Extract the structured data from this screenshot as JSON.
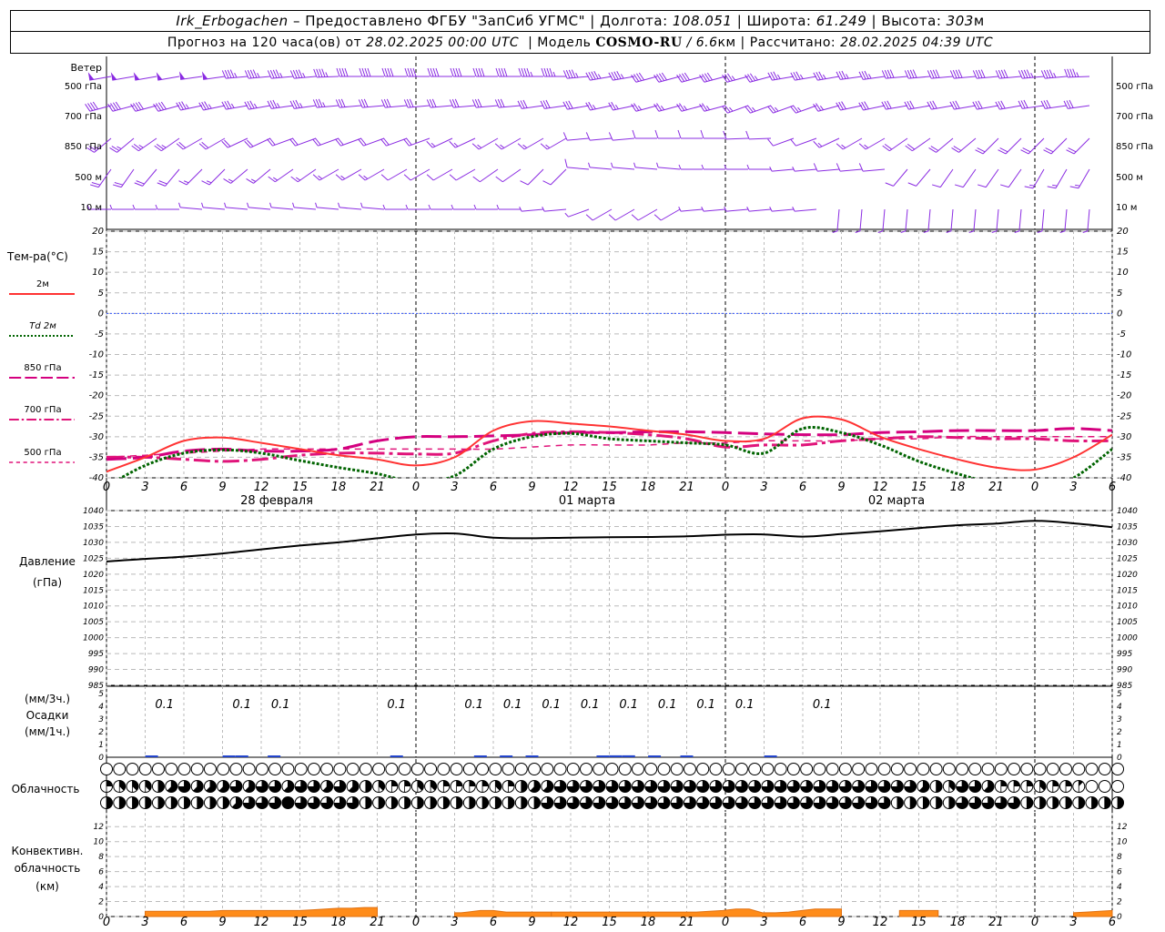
{
  "header": {
    "station": "Irk_Erbogachen",
    "provider": " – Предоставлено ФГБУ \"ЗапСиб УГМС\" | ",
    "lon_label": "Долгота: ",
    "lon": "108.051",
    "lat_label": " | Широта: ",
    "lat": "61.249",
    "alt_label": " | Высота: ",
    "alt": "303",
    "alt_unit": "м",
    "forecast_label": "Прогноз на 120 часа(ов) от ",
    "forecast_start": "28.02.2025 00:00 UTC",
    "model_label": "  | Модель ",
    "model": "COSMO-RU",
    "model_res": " / 6.6",
    "model_res_unit": "км",
    "calc_label": " | Рассчитано: ",
    "calc_time": "28.02.2025 04:39 UTC"
  },
  "wind_panel": {
    "title": "Ветер",
    "levels": [
      "500 гПа",
      "700 гПа",
      "850 гПа",
      "500 м",
      "10  м"
    ]
  },
  "temp_panel": {
    "title": "Тем-ра(°С)",
    "legend": [
      {
        "label": "2м",
        "color": "#ff3333",
        "style": "solid"
      },
      {
        "label": "Td  2м",
        "color": "#006400",
        "style": "dotted"
      },
      {
        "label": "850 гПа",
        "color": "#d4007f",
        "style": "long-dash"
      },
      {
        "label": "700 гПа",
        "color": "#e0147a",
        "style": "dash-dot"
      },
      {
        "label": "500 гПа",
        "color": "#e0147a",
        "style": "short-dash"
      }
    ]
  },
  "pressure_panel": {
    "title": "Давление",
    "unit": "(гПа)"
  },
  "precip_panel": {
    "unit_top": "(мм/3ч.)",
    "title": "Осадки",
    "unit_bottom": "(мм/1ч.)"
  },
  "cloud_panel": {
    "title": "Облачность"
  },
  "conv_panel": {
    "title_1": "Конвективн.",
    "title_2": "облачность",
    "unit": "(км)"
  },
  "time_axis": {
    "hour_ticks": [
      "0",
      "3",
      "6",
      "9",
      "12",
      "15",
      "18",
      "21",
      "0",
      "3",
      "6",
      "9",
      "12",
      "15",
      "18",
      "21",
      "0",
      "3",
      "6",
      "9",
      "12",
      "15",
      "18",
      "21",
      "0",
      "3",
      "6"
    ],
    "days": [
      "28 февраля",
      "01 марта",
      "02 марта"
    ]
  },
  "chart_data": [
    {
      "type": "line",
      "title": "Тем-ра(°С)",
      "x_hours": [
        0,
        3,
        6,
        9,
        12,
        15,
        18,
        21,
        24,
        27,
        30,
        33,
        36,
        39,
        42,
        45,
        48,
        51,
        54,
        57,
        60,
        63,
        66,
        69,
        72,
        75,
        78
      ],
      "ylim": [
        -40,
        20
      ],
      "grid": true,
      "series": [
        {
          "name": "2м",
          "color": "#ff3333",
          "values": [
            -38.5,
            -35,
            -31,
            -30.2,
            -31.5,
            -33,
            -34.5,
            -35.5,
            -37,
            -35,
            -28.5,
            -26.2,
            -26.8,
            -27.5,
            -28.5,
            -29.5,
            -31,
            -30.5,
            -25.5,
            -25.8,
            -30,
            -33,
            -35.5,
            -37.5,
            -38,
            -35,
            -29.5
          ]
        },
        {
          "name": "Td  2м",
          "color": "#006400",
          "values": [
            -42,
            -37,
            -34,
            -33.2,
            -34,
            -35.8,
            -37.5,
            -39,
            -41,
            -39.5,
            -33,
            -30,
            -29.2,
            -30.5,
            -31,
            -31.5,
            -32,
            -34,
            -28,
            -29,
            -32,
            -36,
            -39,
            -41.5,
            -43,
            -40,
            -33
          ]
        },
        {
          "name": "850 гПа",
          "color": "#d4007f",
          "values": [
            -35.5,
            -35,
            -33.5,
            -33,
            -33.5,
            -33.5,
            -33,
            -31,
            -30,
            -30,
            -29.8,
            -29.5,
            -29,
            -29,
            -28.8,
            -28.8,
            -29,
            -29.3,
            -29.5,
            -29.5,
            -29,
            -28.8,
            -28.5,
            -28.5,
            -28.5,
            -28,
            -28.5
          ]
        },
        {
          "name": "700 гПа",
          "color": "#e0147a",
          "values": [
            -35,
            -35,
            -35.5,
            -36,
            -35.5,
            -34.5,
            -34,
            -34,
            -34.2,
            -34,
            -31,
            -29.2,
            -28.8,
            -29,
            -29.5,
            -30.5,
            -32.5,
            -32,
            -32,
            -31,
            -30.5,
            -30,
            -30.2,
            -30.5,
            -30.5,
            -31,
            -31
          ]
        },
        {
          "name": "500 гПа",
          "color": "#e0147a",
          "values": [
            -35,
            -34.5,
            -34,
            -33.5,
            -33,
            -33,
            -33,
            -33,
            -33,
            -33,
            -33,
            -32.5,
            -32,
            -32,
            -32,
            -31.5,
            -31.5,
            -31,
            -31,
            -31,
            -30.5,
            -30.5,
            -30,
            -30,
            -30,
            -30,
            -30
          ]
        }
      ]
    },
    {
      "type": "line",
      "title": "Давление",
      "ylabel": "(гПа)",
      "x_hours": [
        0,
        3,
        6,
        9,
        12,
        15,
        18,
        21,
        24,
        27,
        30,
        33,
        36,
        39,
        42,
        45,
        48,
        51,
        54,
        57,
        60,
        63,
        66,
        69,
        72,
        75,
        78
      ],
      "ylim": [
        985,
        1040
      ],
      "y_ticks": [
        985,
        990,
        995,
        1000,
        1005,
        1010,
        1015,
        1020,
        1025,
        1030,
        1035,
        1040
      ],
      "grid": true,
      "series": [
        {
          "name": "Давление",
          "color": "#000000",
          "values": [
            1024,
            1024.8,
            1025.5,
            1026.5,
            1027.8,
            1029,
            1030,
            1031.3,
            1032.5,
            1032.8,
            1031.5,
            1031.3,
            1031.5,
            1031.6,
            1031.7,
            1031.9,
            1032.4,
            1032.5,
            1031.8,
            1032.6,
            1033.5,
            1034.5,
            1035.4,
            1035.9,
            1036.8,
            1036,
            1034.8
          ]
        }
      ]
    },
    {
      "type": "bar",
      "title": "Осадки",
      "ylabel": "(мм/3ч.) / (мм/1ч.)",
      "ylim": [
        0,
        5
      ],
      "y_ticks": [
        0,
        1,
        2,
        3,
        4,
        5
      ],
      "labels": [
        {
          "x_hour": 4.5,
          "value": "0.1"
        },
        {
          "x_hour": 10.5,
          "value": "0.1"
        },
        {
          "x_hour": 13.5,
          "value": "0.1"
        },
        {
          "x_hour": 22.5,
          "value": "0.1"
        },
        {
          "x_hour": 28.5,
          "value": "0.1"
        },
        {
          "x_hour": 31.5,
          "value": "0.1"
        },
        {
          "x_hour": 34.5,
          "value": "0.1"
        },
        {
          "x_hour": 37.5,
          "value": "0.1"
        },
        {
          "x_hour": 40.5,
          "value": "0.1"
        },
        {
          "x_hour": 43.5,
          "value": "0.1"
        },
        {
          "x_hour": 46.5,
          "value": "0.1"
        },
        {
          "x_hour": 49.5,
          "value": "0.1"
        },
        {
          "x_hour": 55.5,
          "value": "0.1"
        }
      ],
      "hourly_mm": [
        {
          "x_hour": 3.5,
          "value": 0.05
        },
        {
          "x_hour": 9.5,
          "value": 0.05
        },
        {
          "x_hour": 10.5,
          "value": 0.05
        },
        {
          "x_hour": 13,
          "value": 0.05
        },
        {
          "x_hour": 22.5,
          "value": 0.05
        },
        {
          "x_hour": 29,
          "value": 0.05
        },
        {
          "x_hour": 31,
          "value": 0.05
        },
        {
          "x_hour": 33,
          "value": 0.05
        },
        {
          "x_hour": 38.5,
          "value": 0.1
        },
        {
          "x_hour": 39.5,
          "value": 0.15
        },
        {
          "x_hour": 40.5,
          "value": 0.15
        },
        {
          "x_hour": 42.5,
          "value": 0.1
        },
        {
          "x_hour": 45,
          "value": 0.05
        },
        {
          "x_hour": 51.5,
          "value": 0.05
        }
      ]
    },
    {
      "type": "table",
      "title": "Облачность",
      "rows": [
        {
          "level": "upper",
          "octas": [
            0,
            0,
            0,
            0,
            0,
            0,
            0,
            0,
            0,
            0,
            0,
            0,
            0,
            0,
            0,
            0,
            0,
            0,
            0,
            0,
            0,
            0,
            0,
            0,
            0,
            0,
            0,
            0,
            0,
            0,
            0,
            0,
            0,
            0,
            0,
            0,
            0,
            0,
            0,
            0,
            0,
            0,
            0,
            0,
            0,
            0,
            0,
            0,
            0,
            0,
            0,
            0,
            0,
            0,
            0,
            0,
            0,
            0,
            0,
            0,
            0,
            0,
            0,
            0,
            0,
            0,
            0,
            0,
            0,
            0,
            0,
            0,
            0,
            0,
            0,
            0,
            0,
            0,
            0
          ]
        },
        {
          "level": "middle",
          "octas": [
            2,
            3,
            3,
            3,
            4,
            5,
            6,
            5,
            5,
            5,
            6,
            5,
            6,
            6,
            5,
            6,
            6,
            5,
            6,
            5,
            4,
            3,
            2,
            2,
            3,
            3,
            2,
            2,
            2,
            2,
            3,
            2,
            4,
            5,
            5,
            6,
            6,
            6,
            6,
            6,
            6,
            6,
            6,
            6,
            6,
            6,
            6,
            6,
            6,
            6,
            6,
            6,
            6,
            6,
            6,
            6,
            6,
            6,
            6,
            6,
            6,
            6,
            6,
            5,
            4,
            3,
            6,
            6,
            5,
            2,
            2,
            2,
            3,
            2,
            2,
            1,
            0,
            0,
            0,
            0,
            0,
            0,
            0,
            0,
            0,
            0,
            0
          ]
        },
        {
          "level": "lower",
          "octas": [
            4,
            4,
            4,
            4,
            4,
            4,
            4,
            4,
            4,
            4,
            5,
            6,
            6,
            6,
            8,
            6,
            6,
            6,
            6,
            6,
            4,
            4,
            4,
            4,
            4,
            4,
            4,
            4,
            4,
            4,
            4,
            4,
            4,
            4,
            6,
            6,
            6,
            6,
            6,
            6,
            6,
            6,
            6,
            6,
            6,
            6,
            6,
            6,
            6,
            6,
            6,
            6,
            6,
            6,
            6,
            6,
            6,
            6,
            6,
            6,
            6,
            4,
            4,
            4,
            4,
            4,
            6,
            6,
            6,
            6,
            6,
            4,
            4,
            4,
            4,
            4,
            4,
            4,
            4,
            4,
            4,
            4,
            4,
            4,
            4,
            4
          ]
        }
      ]
    },
    {
      "type": "area",
      "title": "Конвективн. облачность",
      "ylabel": "(км)",
      "ylim": [
        0,
        13
      ],
      "y_ticks": [
        0,
        2,
        4,
        6,
        8,
        10,
        12
      ],
      "segments": [
        {
          "from_hour": 3,
          "to_hour": 21,
          "values": [
            0.7,
            0.7,
            0.7,
            0.7,
            0.7,
            0.7,
            0.8,
            0.8,
            0.8,
            0.8,
            0.8,
            0.8,
            0.8,
            0.9,
            1,
            1.1,
            1.1,
            1.2,
            1.2
          ]
        },
        {
          "from_hour": 27,
          "to_hour": 34.5,
          "values": [
            0.5,
            0.5,
            0.6,
            0.7,
            0.8,
            0.8,
            0.8,
            0.7,
            0.6,
            0.6,
            0.6,
            0.6,
            0.6,
            0.6,
            0.6,
            0.6
          ]
        },
        {
          "from_hour": 34.5,
          "to_hour": 57,
          "values": [
            0.6,
            0.6,
            0.6,
            0.6,
            0.6,
            0.6,
            0.6,
            0.6,
            0.6,
            0.6,
            0.6,
            0.6,
            0.7,
            0.8,
            1,
            1,
            0.5,
            0.5,
            0.6,
            0.8,
            1,
            1,
            1
          ]
        },
        {
          "from_hour": 61.5,
          "to_hour": 64.5,
          "values": [
            0.8,
            0.8,
            0.8,
            0.8
          ]
        },
        {
          "from_hour": 75,
          "to_hour": 78,
          "values": [
            0.5,
            0.6,
            0.7,
            0.8
          ]
        }
      ]
    },
    {
      "type": "scatter",
      "title": "Ветер",
      "levels": [
        "500 гПа",
        "700 гПа",
        "850 гПа",
        "500 м",
        "10  м"
      ],
      "direction_deg_per_level": [
        [
          260,
          260,
          262,
          265,
          265,
          268,
          270,
          270,
          270,
          270,
          270,
          265,
          260,
          255,
          255,
          255,
          260,
          260,
          262,
          265,
          265,
          265,
          265,
          268
        ],
        [
          255,
          255,
          258,
          260,
          262,
          265,
          265,
          265,
          265,
          265,
          262,
          260,
          258,
          255,
          255,
          250,
          250,
          255,
          258,
          260,
          260,
          260,
          262,
          262
        ],
        [
          230,
          235,
          240,
          245,
          250,
          250,
          250,
          250,
          245,
          240,
          240,
          265,
          265,
          270,
          270,
          268,
          250,
          245,
          240,
          235,
          230,
          225,
          225,
          225
        ],
        [
          215,
          220,
          225,
          230,
          235,
          240,
          240,
          240,
          240,
          235,
          225,
          275,
          275,
          275,
          270,
          270,
          265,
          265,
          265,
          220,
          215,
          215,
          210,
          210
        ],
        [
          270,
          270,
          275,
          275,
          275,
          275,
          275,
          270,
          270,
          270,
          265,
          250,
          240,
          240,
          265,
          265,
          265,
          185,
          185,
          185,
          185,
          185,
          185,
          185
        ]
      ],
      "speed_ms_per_level": [
        [
          25,
          25,
          25,
          23,
          22,
          22,
          20,
          20,
          20,
          20,
          22,
          22,
          22,
          20,
          20,
          18,
          18,
          18,
          18,
          20,
          20,
          20,
          22,
          22
        ],
        [
          20,
          20,
          18,
          18,
          17,
          17,
          16,
          16,
          16,
          15,
          15,
          14,
          12,
          12,
          12,
          12,
          12,
          12,
          14,
          15,
          15,
          15,
          16,
          16
        ],
        [
          12,
          12,
          11,
          11,
          10,
          10,
          10,
          9,
          8,
          8,
          8,
          6,
          5,
          5,
          5,
          5,
          6,
          7,
          8,
          9,
          9,
          10,
          10,
          10
        ],
        [
          9,
          9,
          8,
          8,
          8,
          7,
          7,
          6,
          5,
          5,
          5,
          4,
          3,
          3,
          3,
          3,
          3,
          4,
          5,
          6,
          6,
          6,
          7,
          7
        ],
        [
          3,
          3,
          3,
          3,
          3,
          3,
          2,
          2,
          2,
          2,
          2,
          3,
          4,
          4,
          2,
          2,
          2,
          3,
          3,
          3,
          3,
          3,
          3,
          3
        ]
      ]
    }
  ]
}
